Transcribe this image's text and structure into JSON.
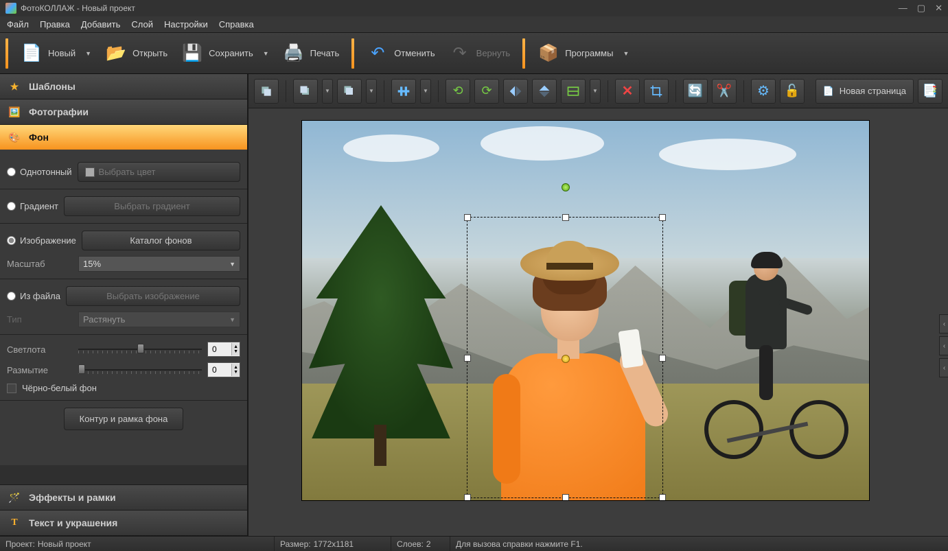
{
  "titlebar": {
    "text": "ФотоКОЛЛАЖ - Новый проект"
  },
  "menu": {
    "file": "Файл",
    "edit": "Правка",
    "add": "Добавить",
    "layer": "Слой",
    "settings": "Настройки",
    "help": "Справка"
  },
  "toolbar": {
    "new": "Новый",
    "open": "Открыть",
    "save": "Сохранить",
    "print": "Печать",
    "undo": "Отменить",
    "redo": "Вернуть",
    "programs": "Программы"
  },
  "sidebar": {
    "templates": "Шаблоны",
    "photos": "Фотографии",
    "background": "Фон",
    "effects": "Эффекты и рамки",
    "text": "Текст и украшения"
  },
  "bg_panel": {
    "solid": "Однотонный",
    "choose_color": "Выбрать цвет",
    "gradient": "Градиент",
    "choose_gradient": "Выбрать градиент",
    "image": "Изображение",
    "catalog": "Каталог фонов",
    "scale_label": "Масштаб",
    "scale_value": "15%",
    "from_file": "Из файла",
    "choose_image": "Выбрать изображение",
    "type_label": "Тип",
    "type_value": "Растянуть",
    "brightness": "Светлота",
    "brightness_val": "0",
    "blur": "Размытие",
    "blur_val": "0",
    "bw": "Чёрно-белый фон",
    "frame": "Контур и рамка фона"
  },
  "canvas_toolbar": {
    "new_page": "Новая страница"
  },
  "status": {
    "project_label": "Проект:",
    "project_name": "Новый проект",
    "size_label": "Размер:",
    "size_val": "1772x1181",
    "layers_label": "Слоев:",
    "layers_val": "2",
    "help": "Для вызова справки нажмите F1."
  }
}
